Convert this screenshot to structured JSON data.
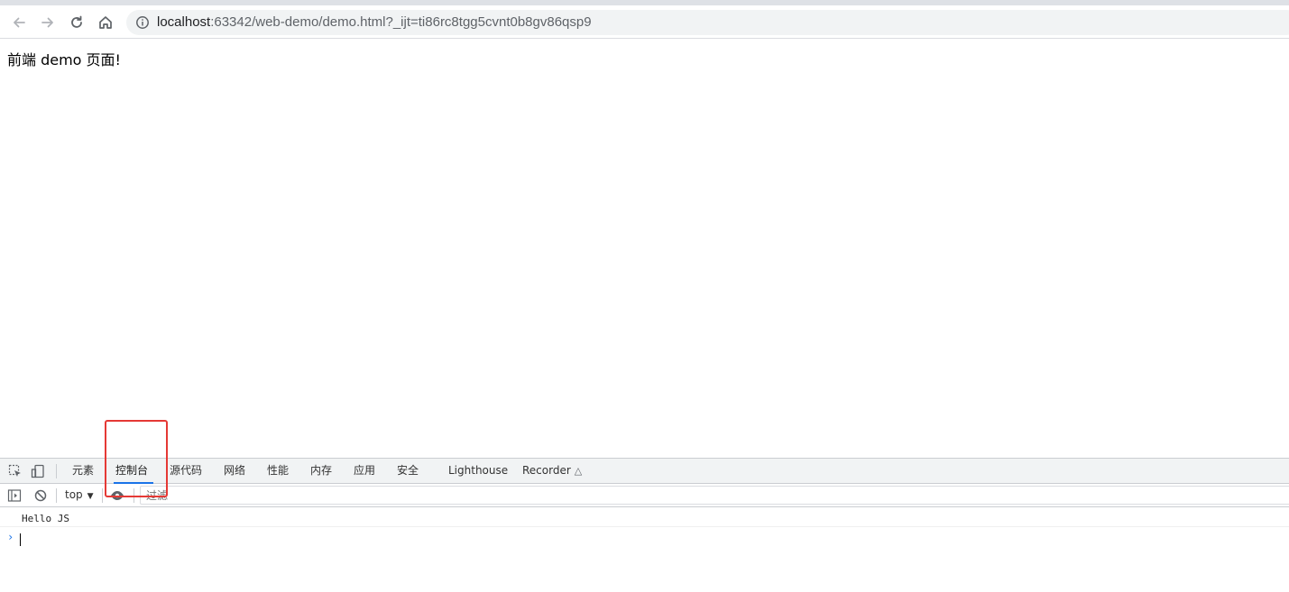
{
  "browser": {
    "url_host": "localhost",
    "url_path": ":63342/web-demo/demo.html?_ijt=ti86rc8tgg5cvnt0b8gv86qsp9"
  },
  "page": {
    "text": "前端 demo 页面!"
  },
  "devtools": {
    "tabs": [
      {
        "label": "元素"
      },
      {
        "label": "控制台"
      },
      {
        "label": "源代码"
      },
      {
        "label": "网络"
      },
      {
        "label": "性能"
      },
      {
        "label": "内存"
      },
      {
        "label": "应用"
      },
      {
        "label": "安全"
      },
      {
        "label": "Lighthouse"
      },
      {
        "label": "Recorder"
      }
    ],
    "active_tab": "控制台",
    "context": "top",
    "filter_placeholder": "过滤",
    "console_output": [
      "Hello JS"
    ]
  },
  "colors": {
    "active_tab_underline": "#1a73e8",
    "annotation": "#e53935"
  }
}
